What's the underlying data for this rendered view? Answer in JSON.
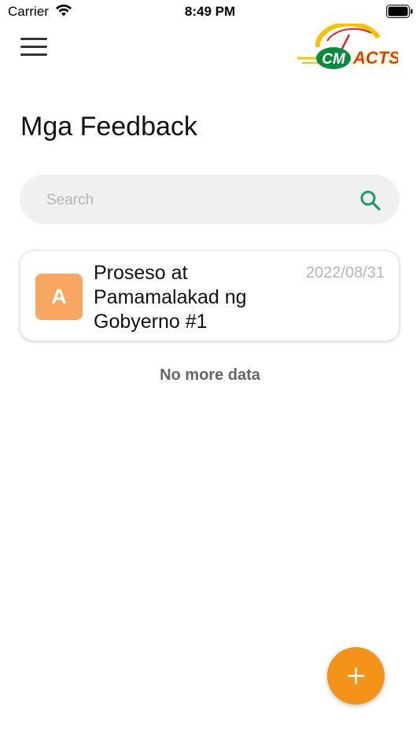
{
  "status_bar": {
    "carrier": "Carrier",
    "time": "8:49 PM",
    "wifi_icon": "wifi-icon",
    "battery_icon": "battery-full-icon"
  },
  "header": {
    "menu_icon": "hamburger-menu-icon",
    "logo_text": "ACTS",
    "logo_badge_text": "CM"
  },
  "page": {
    "title": "Mga Feedback"
  },
  "search": {
    "placeholder": "Search",
    "value": "",
    "icon": "search-icon"
  },
  "feedback_list": [
    {
      "avatar_letter": "A",
      "title": "Proseso at Pamamalakad ng Gobyerno #1",
      "date": "2022/08/31"
    }
  ],
  "list_footer": "No more data",
  "fab": {
    "icon": "plus-icon"
  },
  "colors": {
    "accent": "#f39419",
    "avatar_bg": "#f8a660",
    "search_bg": "#f0f0f0",
    "search_icon": "#1a9e6b",
    "muted_text": "#b5b5b5"
  }
}
